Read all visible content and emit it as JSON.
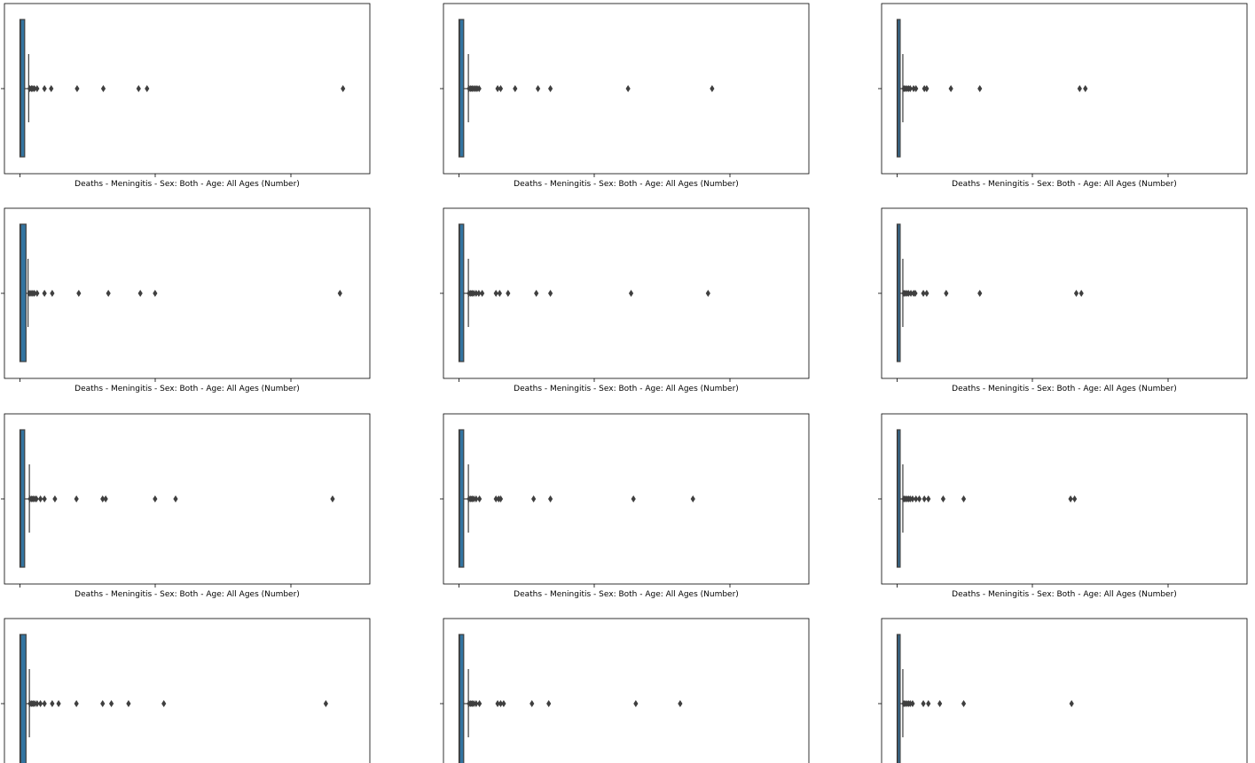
{
  "figure": {
    "box_color": "#3274a1",
    "edge_color": "#3f3f3f",
    "outlier_color": "#3f3f3f"
  },
  "chart_data": [
    {
      "type": "boxplot",
      "orientation": "horizontal",
      "xlabel": "Deaths - Meningitis - Sex: Both - Age: All Ages (Number)",
      "xlim": [
        0,
        100
      ],
      "box": {
        "q1": 0.0,
        "median": 0.2,
        "q3": 1.4,
        "whisker_low": 0.0,
        "whisker_high": 2.6
      },
      "outliers": [
        2.9,
        3.4,
        3.8,
        4.3,
        5.1,
        7.3,
        9.3,
        17.0,
        24.8,
        35.3,
        37.8,
        96.1
      ]
    },
    {
      "type": "boxplot",
      "orientation": "horizontal",
      "xlabel": "Deaths - Meningitis - Sex: Both - Age: All Ages (Number)",
      "xlim": [
        0,
        100
      ],
      "box": {
        "q1": 0.0,
        "median": 0.2,
        "q3": 1.4,
        "whisker_low": 0.0,
        "whisker_high": 2.8
      },
      "outliers": [
        3.0,
        3.5,
        3.9,
        4.4,
        4.9,
        5.4,
        6.0,
        11.5,
        12.4,
        16.7,
        23.5,
        27.2,
        50.3,
        75.3
      ]
    },
    {
      "type": "boxplot",
      "orientation": "horizontal",
      "xlabel": "Deaths - Meningitis - Sex: Both - Age: All Ages (Number)",
      "xlim": [
        0,
        100
      ],
      "box": {
        "q1": 0.0,
        "median": 0.2,
        "q3": 0.9,
        "whisker_low": 0.0,
        "whisker_high": 1.7
      },
      "outliers": [
        2.0,
        2.4,
        2.9,
        3.4,
        3.9,
        4.9,
        5.6,
        8.1,
        8.8,
        16.0,
        24.6,
        54.3,
        56.0
      ]
    },
    {
      "type": "boxplot",
      "orientation": "horizontal",
      "xlabel": "Deaths - Meningitis - Sex: Both - Age: All Ages (Number)",
      "xlim": [
        0,
        100
      ],
      "box": {
        "q1": 0.0,
        "median": 0.2,
        "q3": 1.8,
        "whisker_low": 0.0,
        "whisker_high": 2.4
      },
      "outliers": [
        2.8,
        3.3,
        3.8,
        4.3,
        5.1,
        7.3,
        9.6,
        17.5,
        26.3,
        35.8,
        40.2,
        95.2
      ]
    },
    {
      "type": "boxplot",
      "orientation": "horizontal",
      "xlabel": "Deaths - Meningitis - Sex: Both - Age: All Ages (Number)",
      "xlim": [
        0,
        100
      ],
      "box": {
        "q1": 0.0,
        "median": 0.2,
        "q3": 1.4,
        "whisker_low": 0.0,
        "whisker_high": 2.8
      },
      "outliers": [
        3.0,
        3.5,
        3.9,
        4.4,
        5.1,
        5.9,
        6.9,
        11.0,
        12.1,
        14.6,
        23.0,
        27.2,
        51.2,
        74.1
      ]
    },
    {
      "type": "boxplot",
      "orientation": "horizontal",
      "xlabel": "Deaths - Meningitis - Sex: Both - Age: All Ages (Number)",
      "xlim": [
        0,
        100
      ],
      "box": {
        "q1": 0.0,
        "median": 0.2,
        "q3": 0.9,
        "whisker_low": 0.0,
        "whisker_high": 1.7
      },
      "outliers": [
        2.0,
        2.4,
        2.9,
        3.4,
        4.1,
        4.9,
        5.4,
        7.8,
        8.8,
        14.6,
        24.6,
        53.3,
        54.8
      ]
    },
    {
      "type": "boxplot",
      "orientation": "horizontal",
      "xlabel": "Deaths - Meningitis - Sex: Both - Age: All Ages (Number)",
      "xlim": [
        0,
        100
      ],
      "box": {
        "q1": 0.0,
        "median": 0.2,
        "q3": 1.4,
        "whisker_low": 0.0,
        "whisker_high": 2.8
      },
      "outliers": [
        3.0,
        3.5,
        3.9,
        4.4,
        4.9,
        6.1,
        7.3,
        10.4,
        16.8,
        24.6,
        25.5,
        40.2,
        46.3,
        93.0
      ]
    },
    {
      "type": "boxplot",
      "orientation": "horizontal",
      "xlabel": "Deaths - Meningitis - Sex: Both - Age: All Ages (Number)",
      "xlim": [
        0,
        100
      ],
      "box": {
        "q1": 0.0,
        "median": 0.2,
        "q3": 1.4,
        "whisker_low": 0.0,
        "whisker_high": 2.8
      },
      "outliers": [
        3.0,
        3.5,
        3.9,
        4.4,
        5.1,
        6.1,
        11.0,
        11.8,
        12.4,
        22.2,
        27.2,
        51.9,
        69.6
      ]
    },
    {
      "type": "boxplot",
      "orientation": "horizontal",
      "xlabel": "Deaths - Meningitis - Sex: Both - Age: All Ages (Number)",
      "xlim": [
        0,
        100
      ],
      "box": {
        "q1": 0.0,
        "median": 0.2,
        "q3": 0.9,
        "whisker_low": 0.0,
        "whisker_high": 1.7
      },
      "outliers": [
        2.0,
        2.4,
        2.9,
        3.4,
        3.9,
        4.6,
        5.6,
        6.6,
        8.1,
        9.3,
        13.7,
        19.8,
        51.6,
        52.8
      ]
    },
    {
      "type": "boxplot",
      "orientation": "horizontal",
      "xlabel": "",
      "xlim": [
        0,
        100
      ],
      "box": {
        "q1": 0.0,
        "median": 0.2,
        "q3": 1.8,
        "whisker_low": 0.0,
        "whisker_high": 2.8
      },
      "outliers": [
        3.0,
        3.5,
        3.9,
        4.4,
        5.1,
        6.1,
        7.3,
        9.6,
        11.5,
        16.8,
        24.6,
        27.2,
        32.3,
        42.8,
        91.0
      ]
    },
    {
      "type": "boxplot",
      "orientation": "horizontal",
      "xlabel": "",
      "xlim": [
        0,
        100
      ],
      "box": {
        "q1": 0.0,
        "median": 0.2,
        "q3": 1.4,
        "whisker_low": 0.0,
        "whisker_high": 2.8
      },
      "outliers": [
        3.0,
        3.5,
        3.9,
        4.4,
        5.1,
        6.1,
        11.5,
        12.4,
        13.3,
        21.7,
        26.7,
        52.6,
        65.8
      ]
    },
    {
      "type": "boxplot",
      "orientation": "horizontal",
      "xlabel": "",
      "xlim": [
        0,
        100
      ],
      "box": {
        "q1": 0.0,
        "median": 0.2,
        "q3": 0.9,
        "whisker_low": 0.0,
        "whisker_high": 1.7
      },
      "outliers": [
        2.0,
        2.4,
        2.9,
        3.4,
        3.9,
        4.6,
        7.8,
        9.3,
        12.7,
        19.8,
        51.9
      ]
    }
  ]
}
